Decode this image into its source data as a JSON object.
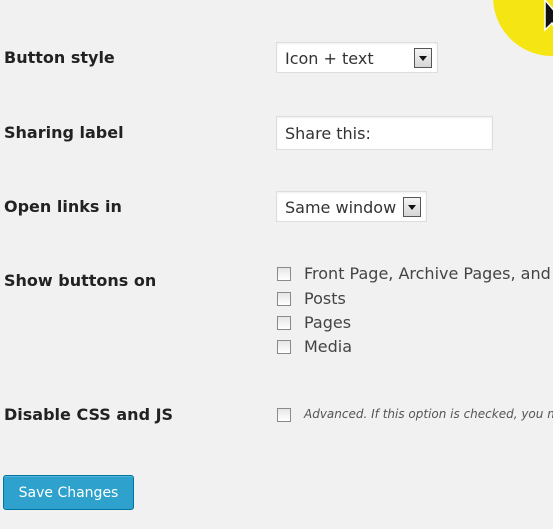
{
  "settings": {
    "button_style": {
      "label": "Button style",
      "value": "Icon + text"
    },
    "sharing_label": {
      "label": "Sharing label",
      "value": "Share this:"
    },
    "open_links": {
      "label": "Open links in",
      "value": "Same window"
    },
    "show_buttons": {
      "label": "Show buttons on",
      "options": [
        {
          "label": "Front Page, Archive Pages, and",
          "checked": false
        },
        {
          "label": "Posts",
          "checked": false
        },
        {
          "label": "Pages",
          "checked": false
        },
        {
          "label": "Media",
          "checked": false
        }
      ]
    },
    "disable_css": {
      "label": "Disable CSS and JS",
      "description": "Advanced. If this option is checked, you m",
      "checked": false
    }
  },
  "actions": {
    "save_label": "Save Changes"
  },
  "colors": {
    "primary_button": "#2ea2cc",
    "cursor_highlight": "#f5e512"
  },
  "icons": {
    "cursor": "mouse-pointer-icon",
    "dropdown": "chevron-down-icon"
  }
}
